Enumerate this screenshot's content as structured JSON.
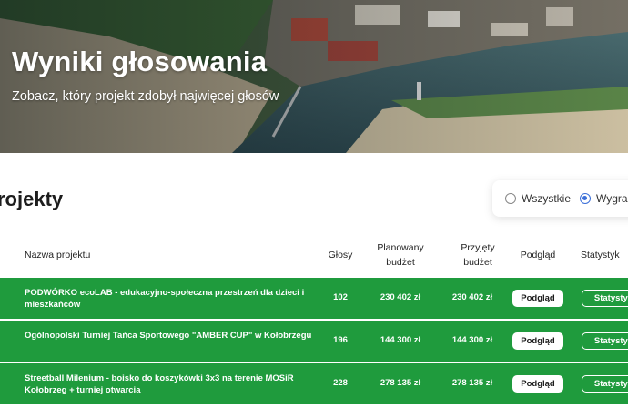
{
  "hero": {
    "title": "Wyniki głosowania",
    "subtitle": "Zobacz, który projekt zdobył najwięcej głosów"
  },
  "section": {
    "title": "rojekty"
  },
  "filter": {
    "options": [
      {
        "label": "Wszystkie",
        "selected": false
      },
      {
        "label": "Wygran",
        "selected": true
      }
    ]
  },
  "table": {
    "headers": {
      "name": "Nazwa projektu",
      "votes": "Głosy",
      "planned_line1": "Planowany",
      "planned_line2": "budżet",
      "accepted_line1": "Przyjęty",
      "accepted_line2": "budżet",
      "preview": "Podgląd",
      "stats": "Statystyk"
    },
    "rows": [
      {
        "name": "PODWÓRKO ecoLAB - edukacyjno-społeczna przestrzeń dla dzieci i mieszkańców",
        "votes": "102",
        "planned": "230 402 zł",
        "accepted": "230 402 zł",
        "preview_label": "Podgląd",
        "stats_label": "Statystyk"
      },
      {
        "name": "Ogólnopolski Turniej Tańca Sportowego \"AMBER CUP\" w Kołobrzegu",
        "votes": "196",
        "planned": "144 300 zł",
        "accepted": "144 300 zł",
        "preview_label": "Podgląd",
        "stats_label": "Statystyk"
      },
      {
        "name": "Streetball Milenium - boisko do koszykówki 3x3 na terenie MOSiR Kołobrzeg + turniej otwarcia",
        "votes": "228",
        "planned": "278 135 zł",
        "accepted": "278 135 zł",
        "preview_label": "Podgląd",
        "stats_label": "Statystyk"
      }
    ]
  },
  "colors": {
    "row_green": "#1f9b3d",
    "radio_accent": "#3b6fd8"
  }
}
